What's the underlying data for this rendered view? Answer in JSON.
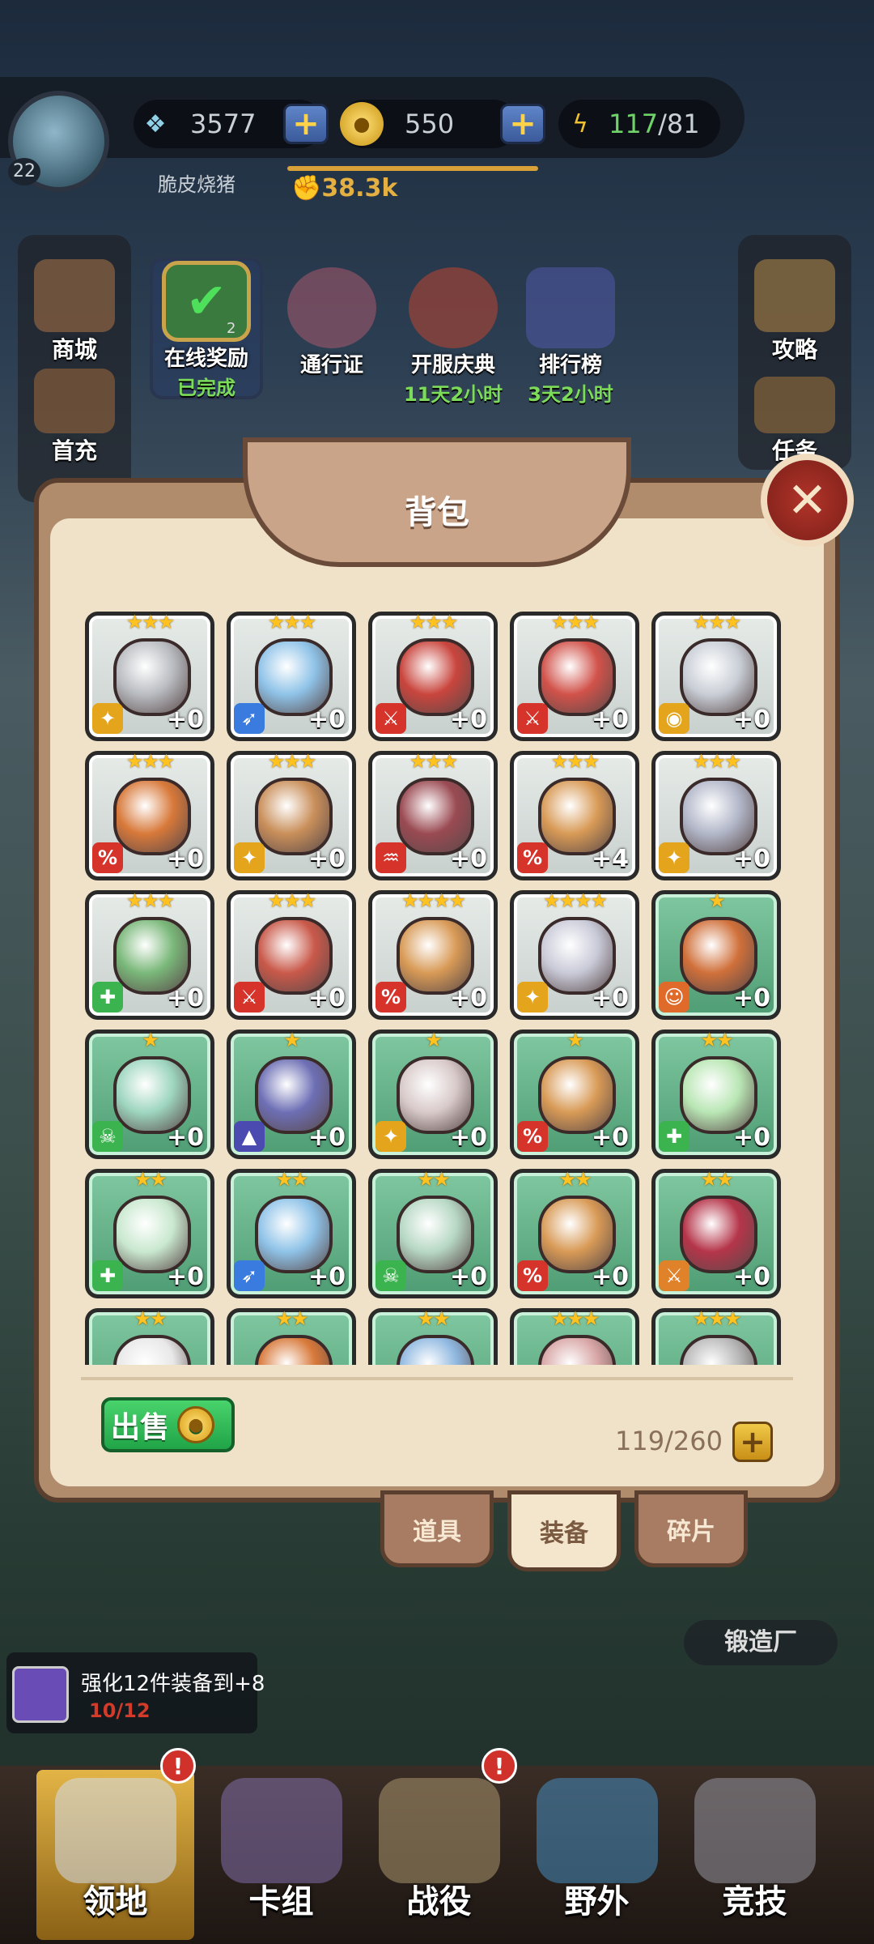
{
  "player": {
    "level": "22",
    "name": "脆皮烧猪",
    "power": "38.3k"
  },
  "resources": {
    "gems": "3577",
    "gold": "550",
    "stamina_current": "117",
    "stamina_max": "/81"
  },
  "left_menu": [
    {
      "label": "商城"
    },
    {
      "label": "首充"
    }
  ],
  "right_menu": [
    {
      "label": "攻略"
    },
    {
      "label": "任务"
    }
  ],
  "events": [
    {
      "label": "在线奖励",
      "sub": "已完成",
      "badge": "2"
    },
    {
      "label": "通行证",
      "sub": ""
    },
    {
      "label": "开服庆典",
      "sub": "11天2小时"
    },
    {
      "label": "排行榜",
      "sub": "3天2小时"
    }
  ],
  "panel": {
    "title": "背包",
    "close_icon": "✕",
    "sell_label": "出售",
    "capacity": "119/260",
    "capacity_plus": "+"
  },
  "items": [
    {
      "stars": "★★★",
      "rarity": "white",
      "category": "dagger",
      "cat_color": "#e4a51c",
      "art": "#b9bcc1",
      "level": "+0"
    },
    {
      "stars": "★★★",
      "rarity": "white",
      "category": "run",
      "cat_color": "#3a7be0",
      "art": "#8fc3e8",
      "level": "+0"
    },
    {
      "stars": "★★★",
      "rarity": "white",
      "category": "sword",
      "cat_color": "#d6342b",
      "art": "#c9453d",
      "level": "+0"
    },
    {
      "stars": "★★★",
      "rarity": "white",
      "category": "sword",
      "cat_color": "#d6342b",
      "art": "#d1524a",
      "level": "+0"
    },
    {
      "stars": "★★★",
      "rarity": "white",
      "category": "eye",
      "cat_color": "#e4a51c",
      "art": "#c9ced6",
      "level": "+0"
    },
    {
      "stars": "★★★",
      "rarity": "white",
      "category": "crit",
      "cat_color": "#d6342b",
      "art": "#d8793a",
      "level": "+0"
    },
    {
      "stars": "★★★",
      "rarity": "white",
      "category": "dagger",
      "cat_color": "#e4a51c",
      "art": "#c98f5a",
      "level": "+0"
    },
    {
      "stars": "★★★",
      "rarity": "white",
      "category": "fangs",
      "cat_color": "#d6342b",
      "art": "#9a4a52",
      "level": "+0"
    },
    {
      "stars": "★★★",
      "rarity": "white",
      "category": "crit",
      "cat_color": "#d6342b",
      "art": "#d89a56",
      "level": "+4"
    },
    {
      "stars": "★★★",
      "rarity": "white",
      "category": "dagger",
      "cat_color": "#e4a51c",
      "art": "#b2b7c9",
      "level": "+0"
    },
    {
      "stars": "★★★",
      "rarity": "white",
      "category": "heal",
      "cat_color": "#3bb34e",
      "art": "#7ab87a",
      "level": "+0"
    },
    {
      "stars": "★★★",
      "rarity": "white",
      "category": "sword",
      "cat_color": "#d6342b",
      "art": "#c9594a",
      "level": "+0"
    },
    {
      "stars": "★★★★",
      "rarity": "white",
      "category": "crit",
      "cat_color": "#d6342b",
      "art": "#d89a56",
      "level": "+0"
    },
    {
      "stars": "★★★★",
      "rarity": "white",
      "category": "dagger",
      "cat_color": "#e4a51c",
      "art": "#c9cad8",
      "level": "+0"
    },
    {
      "stars": "★",
      "rarity": "green",
      "category": "face",
      "cat_color": "#e06a2a",
      "art": "#d0703a",
      "level": "+0"
    },
    {
      "stars": "★",
      "rarity": "green",
      "category": "skull",
      "cat_color": "#3bb34e",
      "art": "#9ed6c0",
      "level": "+0"
    },
    {
      "stars": "★",
      "rarity": "green",
      "category": "magic",
      "cat_color": "#4a4ab0",
      "art": "#6d6fb5",
      "level": "+0"
    },
    {
      "stars": "★",
      "rarity": "green",
      "category": "dagger",
      "cat_color": "#e4a51c",
      "art": "#d8c9c9",
      "level": "+0"
    },
    {
      "stars": "★",
      "rarity": "green",
      "category": "crit",
      "cat_color": "#d6342b",
      "art": "#d89a56",
      "level": "+0"
    },
    {
      "stars": "★★",
      "rarity": "green",
      "category": "heal",
      "cat_color": "#3bb34e",
      "art": "#b9e6b4",
      "level": "+0"
    },
    {
      "stars": "★★",
      "rarity": "green",
      "category": "heal",
      "cat_color": "#3bb34e",
      "art": "#c9e8cf",
      "level": "+0"
    },
    {
      "stars": "★★",
      "rarity": "green",
      "category": "run",
      "cat_color": "#3a7be0",
      "art": "#8fc3e8",
      "level": "+0"
    },
    {
      "stars": "★★",
      "rarity": "green",
      "category": "skull",
      "cat_color": "#3bb34e",
      "art": "#b7d8c4",
      "level": "+0"
    },
    {
      "stars": "★★",
      "rarity": "green",
      "category": "crit",
      "cat_color": "#d6342b",
      "art": "#d89a56",
      "level": "+0"
    },
    {
      "stars": "★★",
      "rarity": "green",
      "category": "sword",
      "cat_color": "#e0822a",
      "art": "#b5354a",
      "level": "+0"
    },
    {
      "stars": "★★",
      "rarity": "green",
      "category": "",
      "cat_color": "",
      "art": "#e8e8e8",
      "level": ""
    },
    {
      "stars": "★★",
      "rarity": "green",
      "category": "",
      "cat_color": "",
      "art": "#d8793a",
      "level": ""
    },
    {
      "stars": "★★",
      "rarity": "green",
      "category": "",
      "cat_color": "",
      "art": "#8fb8e0",
      "level": ""
    },
    {
      "stars": "★★★",
      "rarity": "green",
      "category": "",
      "cat_color": "",
      "art": "#d8a5a5",
      "level": ""
    },
    {
      "stars": "★★★",
      "rarity": "green",
      "category": "",
      "cat_color": "",
      "art": "#b8b8b8",
      "level": ""
    }
  ],
  "tabs": [
    {
      "label": "道具",
      "active": false
    },
    {
      "label": "装备",
      "active": true
    },
    {
      "label": "碎片",
      "active": false
    }
  ],
  "forge_label": "锻造厂",
  "quest": {
    "text": "强化12件装备到+8",
    "sub": "10/12"
  },
  "bottom_nav": [
    {
      "label": "领地",
      "active": true,
      "alert": true
    },
    {
      "label": "卡组",
      "active": false,
      "alert": false
    },
    {
      "label": "战役",
      "active": false,
      "alert": true
    },
    {
      "label": "野外",
      "active": false,
      "alert": false
    },
    {
      "label": "竞技",
      "active": false,
      "alert": false
    }
  ],
  "icons": {
    "gem": "fish-gem-icon",
    "gold": "gold-coin-icon",
    "stamina": "lightning-icon",
    "power": "fist-icon",
    "alert": "!"
  }
}
